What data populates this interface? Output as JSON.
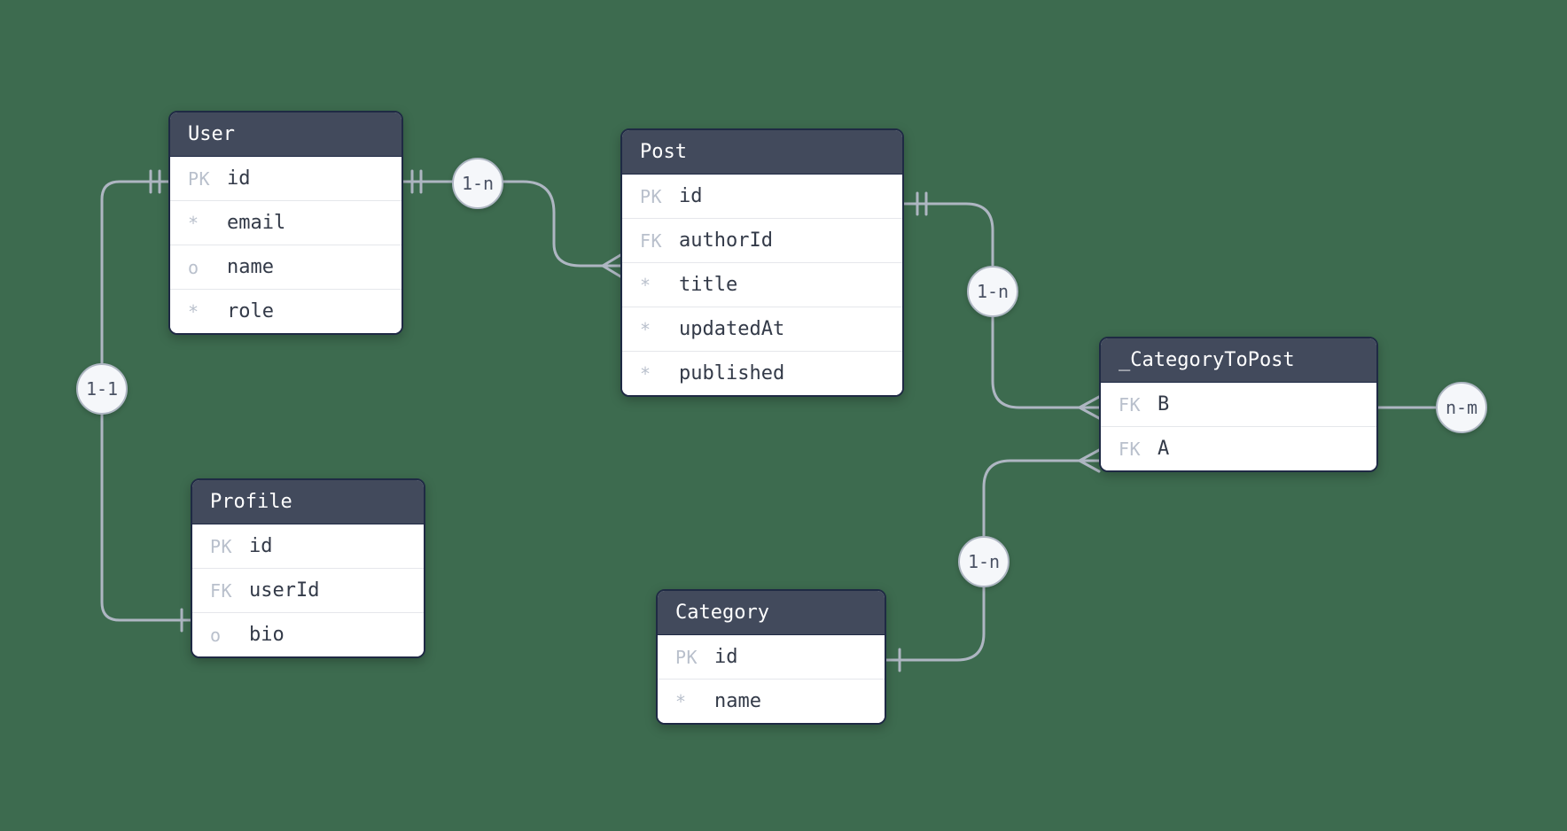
{
  "entities": {
    "user": {
      "name": "User",
      "rows": [
        {
          "key": "PK",
          "field": "id"
        },
        {
          "key": "*",
          "field": "email"
        },
        {
          "key": "o",
          "field": "name"
        },
        {
          "key": "*",
          "field": "role"
        }
      ]
    },
    "profile": {
      "name": "Profile",
      "rows": [
        {
          "key": "PK",
          "field": "id"
        },
        {
          "key": "FK",
          "field": "userId"
        },
        {
          "key": "o",
          "field": "bio"
        }
      ]
    },
    "post": {
      "name": "Post",
      "rows": [
        {
          "key": "PK",
          "field": "id"
        },
        {
          "key": "FK",
          "field": "authorId"
        },
        {
          "key": "*",
          "field": "title"
        },
        {
          "key": "*",
          "field": "updatedAt"
        },
        {
          "key": "*",
          "field": "published"
        }
      ]
    },
    "category": {
      "name": "Category",
      "rows": [
        {
          "key": "PK",
          "field": "id"
        },
        {
          "key": "*",
          "field": "name"
        }
      ]
    },
    "categoryToPost": {
      "name": "_CategoryToPost",
      "rows": [
        {
          "key": "FK",
          "field": "B"
        },
        {
          "key": "FK",
          "field": "A"
        }
      ]
    }
  },
  "relationships": {
    "userProfile": "1-1",
    "userPost": "1-n",
    "postCategoryToPost": "1-n",
    "categoryCategoryToPost": "1-n",
    "categoryToPostSelf": "n-m"
  }
}
